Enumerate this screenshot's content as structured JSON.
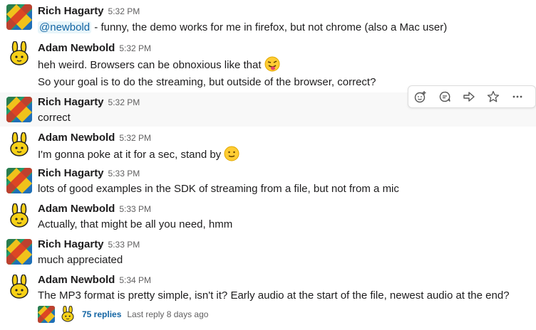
{
  "colors": {
    "mention_bg": "#e8f5fa",
    "link": "#1264a3",
    "hover_bg": "#f8f8f8"
  },
  "messages": [
    {
      "author": "Rich Hagarty",
      "time": "5:32 PM",
      "mention": "@newbold",
      "text": " - funny, the demo works for me in firefox, but not chrome (also a Mac user)"
    },
    {
      "author": "Adam Newbold",
      "time": "5:32 PM",
      "lines": [
        "heh weird. Browsers can be obnoxious like that",
        "So your goal is to do the streaming, but outside of the browser, correct?"
      ],
      "emoji": "stuck-out-tongue-winking-eye"
    },
    {
      "author": "Rich Hagarty",
      "time": "5:32 PM",
      "text": "correct"
    },
    {
      "author": "Adam Newbold",
      "time": "5:32 PM",
      "text": "I'm gonna poke at it for a sec, stand by",
      "emoji": "slightly-smiling-face"
    },
    {
      "author": "Rich Hagarty",
      "time": "5:33 PM",
      "text": "lots of good examples in the SDK of streaming from a file, but not from a mic"
    },
    {
      "author": "Adam Newbold",
      "time": "5:33 PM",
      "text": "Actually, that might be all you need, hmm"
    },
    {
      "author": "Rich Hagarty",
      "time": "5:33 PM",
      "text": "much appreciated"
    },
    {
      "author": "Adam Newbold",
      "time": "5:34 PM",
      "text": "The MP3 format is pretty simple, isn't it? Early audio at the start of the file, newest audio at the end?"
    }
  ],
  "thread": {
    "replies": "75 replies",
    "last_reply": "Last reply 8 days ago"
  },
  "toolbar": {
    "icons": [
      "add-reaction-icon",
      "reply-thread-icon",
      "share-message-icon",
      "star-icon",
      "more-actions-icon"
    ]
  }
}
